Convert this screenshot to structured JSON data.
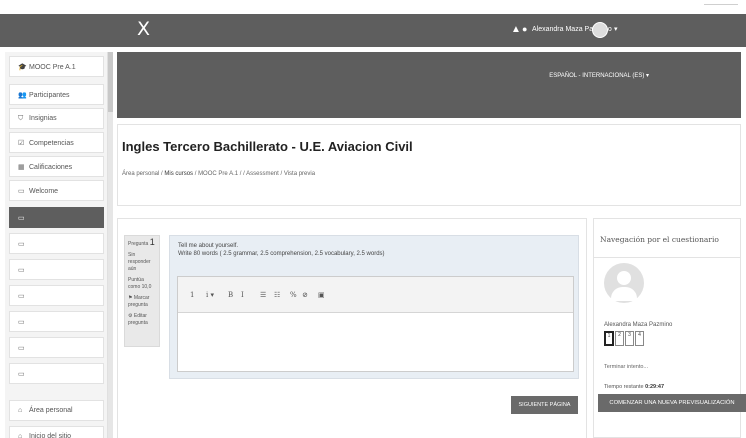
{
  "topbar": {
    "brand": "X",
    "notification_icon": "bell-icon",
    "message_icon": "chat-icon",
    "user_name": "Alexandra Maza Pazmino",
    "caret": "▾"
  },
  "sidebar": {
    "items": [
      {
        "icon": "graduation-cap-icon",
        "glyph": "🎓",
        "label": "MOOC Pre A.1"
      },
      {
        "icon": "users-icon",
        "glyph": "👥",
        "label": "Participantes"
      },
      {
        "icon": "shield-icon",
        "glyph": "⛉",
        "label": "Insignias"
      },
      {
        "icon": "check-square-icon",
        "glyph": "☑",
        "label": "Competencias"
      },
      {
        "icon": "grid-icon",
        "glyph": "▦",
        "label": "Calificaciones"
      },
      {
        "icon": "folder-icon",
        "glyph": "▭",
        "label": "Welcome"
      },
      {
        "icon": "folder-icon",
        "glyph": "▭",
        "label": ""
      },
      {
        "icon": "folder-icon",
        "glyph": "▭",
        "label": ""
      },
      {
        "icon": "folder-icon",
        "glyph": "▭",
        "label": ""
      },
      {
        "icon": "folder-icon",
        "glyph": "▭",
        "label": ""
      },
      {
        "icon": "folder-icon",
        "glyph": "▭",
        "label": ""
      },
      {
        "icon": "folder-icon",
        "glyph": "▭",
        "label": ""
      },
      {
        "icon": "folder-icon",
        "glyph": "▭",
        "label": ""
      },
      {
        "icon": "dashboard-icon",
        "glyph": "⌂",
        "label": "Área personal"
      },
      {
        "icon": "home-icon",
        "glyph": "⌂",
        "label": "Inicio del sitio"
      }
    ],
    "active_index": 6
  },
  "banner": {
    "language": "ESPAÑOL - INTERNACIONAL (ES) ▾"
  },
  "header": {
    "title": "Ingles Tercero Bachillerato - U.E. Aviacion Civil",
    "crumbs": [
      "Área personal",
      "Mis cursos",
      "MOOC Pre A.1",
      "",
      "Assessment",
      "Vista previa"
    ],
    "sep": " / "
  },
  "question": {
    "label": "Pregunta",
    "number": "1",
    "status": "Sin responder aún",
    "marks": "Puntúa como 10,0",
    "flag": "Marcar pregunta",
    "edit": "Editar pregunta",
    "prompt_line1": "Tell me about yourself.",
    "prompt_line2": "Write 80 words ( 2.5 grammar, 2.5 comprehension, 2.5 vocabulary, 2.5 words)",
    "answer_value": "",
    "toolbar": [
      {
        "icon": "paragraph-icon",
        "glyph": "1"
      },
      {
        "icon": "info-icon",
        "glyph": "i ▾"
      },
      {
        "icon": "bold-icon",
        "glyph": "B"
      },
      {
        "icon": "italic-icon",
        "glyph": "I"
      },
      {
        "icon": "bullet-list-icon",
        "glyph": "☰"
      },
      {
        "icon": "numbered-list-icon",
        "glyph": "☷"
      },
      {
        "icon": "link-icon",
        "glyph": "%"
      },
      {
        "icon": "unlink-icon",
        "glyph": "⊘"
      },
      {
        "icon": "image-icon",
        "glyph": "▣"
      }
    ],
    "next_button": "SIGUIENTE PÁGINA"
  },
  "quiz_nav": {
    "title": "Navegación por el cuestionario",
    "user_name": "Alexandra Maza Pazmino",
    "questions": [
      "1",
      "2",
      "3",
      "4"
    ],
    "current": 0,
    "finish_link": "Terminar intento...",
    "timer_label": "Tiempo restante",
    "timer_value": "0:29:47",
    "new_preview_button": "COMENZAR UNA NUEVA PREVISUALIZACIÓN"
  }
}
